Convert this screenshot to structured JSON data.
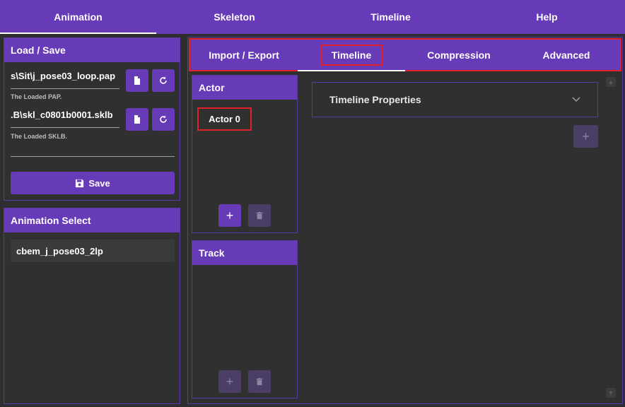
{
  "nav": {
    "tabs": [
      {
        "label": "Animation"
      },
      {
        "label": "Skeleton"
      },
      {
        "label": "Timeline"
      },
      {
        "label": "Help"
      }
    ]
  },
  "load_save": {
    "title": "Load / Save",
    "pap_path": "s\\Sit\\j_pose03_loop.pap",
    "pap_hint": "The Loaded PAP.",
    "sklb_path": ".B\\skl_c0801b0001.sklb",
    "sklb_hint": "The Loaded SKLB.",
    "extra_value": "",
    "save_label": "Save"
  },
  "animation_select": {
    "title": "Animation Select",
    "items": [
      {
        "label": "cbem_j_pose03_2lp"
      }
    ]
  },
  "subtabs": [
    {
      "label": "Import / Export"
    },
    {
      "label": "Timeline"
    },
    {
      "label": "Compression"
    },
    {
      "label": "Advanced"
    }
  ],
  "actor": {
    "title": "Actor",
    "items": [
      {
        "label": "Actor 0"
      }
    ],
    "add_symbol": "+",
    "delete_symbol": "🗑"
  },
  "track": {
    "title": "Track",
    "add_symbol": "+",
    "delete_symbol": "🗑"
  },
  "timeline_properties": {
    "label": "Timeline Properties",
    "chevron": "⌄",
    "add_symbol": "+"
  },
  "colors": {
    "primary": "#673ab7",
    "highlight": "#e0202b",
    "background": "#2e2e2e"
  }
}
